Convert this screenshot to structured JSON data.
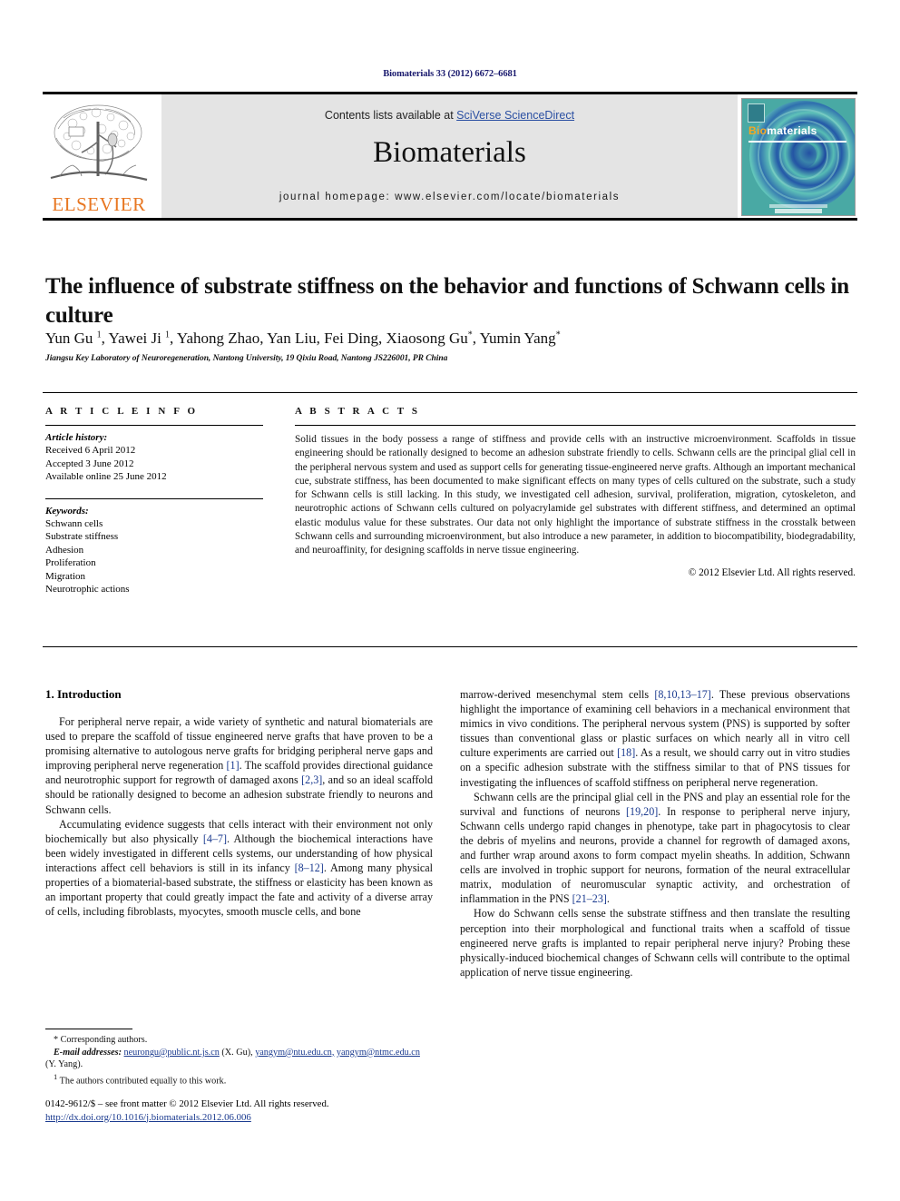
{
  "running_head": "Biomaterials 33 (2012) 6672–6681",
  "masthead": {
    "contents_prefix": "Contents lists available at ",
    "sciencedirect_link": "SciVerse ScienceDirect",
    "journal_name": "Biomaterials",
    "homepage_label": "journal homepage: www.elsevier.com/locate/biomaterials",
    "publisher_name": "ELSEVIER",
    "cover_title_part1": "Bio",
    "cover_title_part2": "materials"
  },
  "article": {
    "title": "The influence of substrate stiffness on the behavior and functions of Schwann cells in culture",
    "authors": "Yun Gu 1, Yawei Ji 1, Yahong Zhao, Yan Liu, Fei Ding, Xiaosong Gu*, Yumin Yang*",
    "affiliation": "Jiangsu Key Laboratory of Neuroregeneration, Nantong University, 19 Qixiu Road, Nantong JS226001, PR China"
  },
  "article_info": {
    "heading": "A R T I C L E   I N F O",
    "history_label": "Article history:",
    "history": [
      "Received 6 April 2012",
      "Accepted 3 June 2012",
      "Available online 25 June 2012"
    ],
    "keywords_label": "Keywords:",
    "keywords": [
      "Schwann cells",
      "Substrate stiffness",
      "Adhesion",
      "Proliferation",
      "Migration",
      "Neurotrophic actions"
    ]
  },
  "abstract": {
    "heading": "A B S T R A C T S",
    "text": "Solid tissues in the body possess a range of stiffness and provide cells with an instructive microenvironment. Scaffolds in tissue engineering should be rationally designed to become an adhesion substrate friendly to cells. Schwann cells are the principal glial cell in the peripheral nervous system and used as support cells for generating tissue-engineered nerve grafts. Although an important mechanical cue, substrate stiffness, has been documented to make significant effects on many types of cells cultured on the substrate, such a study for Schwann cells is still lacking. In this study, we investigated cell adhesion, survival, proliferation, migration, cytoskeleton, and neurotrophic actions of Schwann cells cultured on polyacrylamide gel substrates with different stiffness, and determined an optimal elastic modulus value for these substrates. Our data not only highlight the importance of substrate stiffness in the crosstalk between Schwann cells and surrounding microenvironment, but also introduce a new parameter, in addition to biocompatibility, biodegradability, and neuroaffinity, for designing scaffolds in nerve tissue engineering.",
    "copyright": "© 2012 Elsevier Ltd. All rights reserved."
  },
  "body": {
    "section_number_title": "1. Introduction",
    "left_paragraphs": [
      "For peripheral nerve repair, a wide variety of synthetic and natural biomaterials are used to prepare the scaffold of tissue engineered nerve grafts that have proven to be a promising alternative to autologous nerve grafts for bridging peripheral nerve gaps and improving peripheral nerve regeneration [1]. The scaffold provides directional guidance and neurotrophic support for regrowth of damaged axons [2,3], and so an ideal scaffold should be rationally designed to become an adhesion substrate friendly to neurons and Schwann cells.",
      "Accumulating evidence suggests that cells interact with their environment not only biochemically but also physically [4–7]. Although the biochemical interactions have been widely investigated in different cells systems, our understanding of how physical interactions affect cell behaviors is still in its infancy [8–12]. Among many physical properties of a biomaterial-based substrate, the stiffness or elasticity has been known as an important property that could greatly impact the fate and activity of a diverse array of cells, including fibroblasts, myocytes, smooth muscle cells, and bone"
    ],
    "right_paragraphs": [
      "marrow-derived mesenchymal stem cells [8,10,13–17]. These previous observations highlight the importance of examining cell behaviors in a mechanical environment that mimics in vivo conditions. The peripheral nervous system (PNS) is supported by softer tissues than conventional glass or plastic surfaces on which nearly all in vitro cell culture experiments are carried out [18]. As a result, we should carry out in vitro studies on a specific adhesion substrate with the stiffness similar to that of PNS tissues for investigating the influences of scaffold stiffness on peripheral nerve regeneration.",
      "Schwann cells are the principal glial cell in the PNS and play an essential role for the survival and functions of neurons [19,20]. In response to peripheral nerve injury, Schwann cells undergo rapid changes in phenotype, take part in phagocytosis to clear the debris of myelins and neurons, provide a channel for regrowth of damaged axons, and further wrap around axons to form compact myelin sheaths. In addition, Schwann cells are involved in trophic support for neurons, formation of the neural extracellular matrix, modulation of neuromuscular synaptic activity, and orchestration of inflammation in the PNS [21–23].",
      "How do Schwann cells sense the substrate stiffness and then translate the resulting perception into their morphological and functional traits when a scaffold of tissue engineered nerve grafts is implanted to repair peripheral nerve injury? Probing these physically-induced biochemical changes of Schwann cells will contribute to the optimal application of nerve tissue engineering."
    ]
  },
  "footnotes": {
    "corresponding": "* Corresponding authors.",
    "email_label": "E-mail addresses:",
    "email_1": "neurongu@public.nt.js.cn",
    "email_1_owner": "(X. Gu),",
    "email_2": "yangym@ntu.edu.cn,",
    "email_3": "yangym@ntmc.edu.cn",
    "email_3_owner": "(Y. Yang).",
    "equal_contribution_marker": "1",
    "equal_contribution": "The authors contributed equally to this work."
  },
  "frontmatter": {
    "line1": "0142-9612/$ – see front matter © 2012 Elsevier Ltd. All rights reserved.",
    "doi": "http://dx.doi.org/10.1016/j.biomaterials.2012.06.006"
  },
  "colors": {
    "link_blue": "#1a3a8f",
    "elsevier_orange": "#E87722",
    "masthead_grey": "#e4e4e4",
    "cover_teal": "#3fa8a0"
  }
}
